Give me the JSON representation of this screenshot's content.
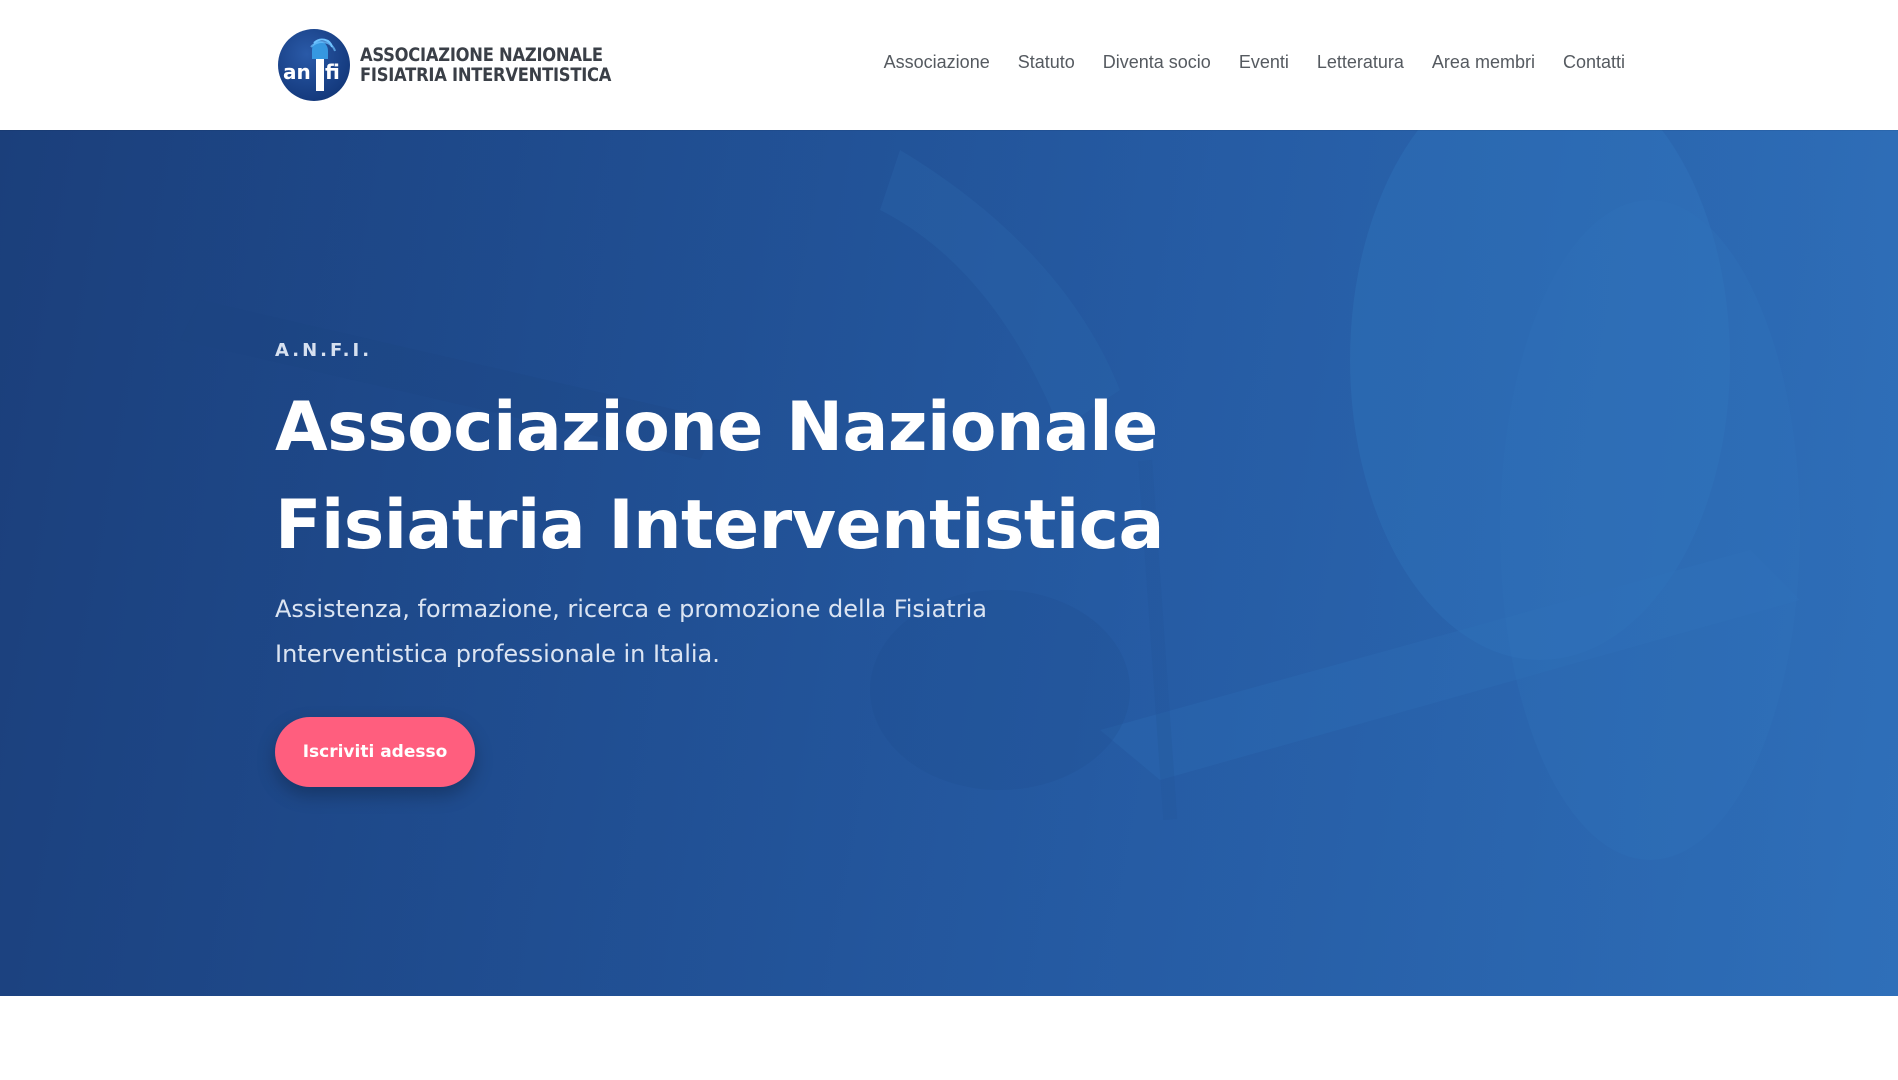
{
  "logo": {
    "mark_text_left": "an",
    "mark_text_right": "fi",
    "line1": "ASSOCIAZIONE NAZIONALE",
    "line2": "FISIATRIA INTERVENTISTICA"
  },
  "nav": {
    "items": [
      {
        "label": "Associazione"
      },
      {
        "label": "Statuto"
      },
      {
        "label": "Diventa socio"
      },
      {
        "label": "Eventi"
      },
      {
        "label": "Letteratura"
      },
      {
        "label": "Area membri"
      },
      {
        "label": "Contatti"
      }
    ]
  },
  "hero": {
    "eyebrow": "A.N.F.I.",
    "title_line1": "Associazione Nazionale",
    "title_line2": "Fisiatria Interventistica",
    "subtitle": "Assistenza, formazione, ricerca e promozione della Fisiatria Interventistica professionale in Italia.",
    "cta_label": "Iscriviti adesso"
  },
  "colors": {
    "brand_dark": "#153b7f",
    "hero_gradient_start": "#1b3f7b",
    "hero_gradient_end": "#2b69b3",
    "cta": "#ff5e7e",
    "nav_text": "#555a60"
  }
}
